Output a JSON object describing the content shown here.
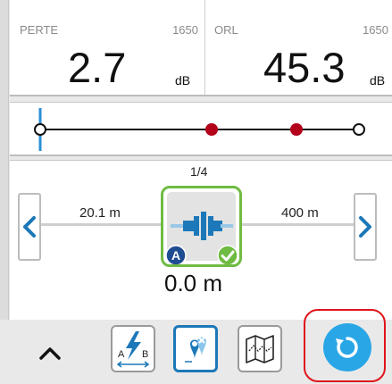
{
  "measurements": {
    "loss": {
      "label": "PERTE",
      "wavelength": "1650",
      "value": "2.7",
      "unit": "dB"
    },
    "orl": {
      "label": "ORL",
      "wavelength": "1650",
      "value": "45.3",
      "unit": "dB"
    }
  },
  "link_map": {
    "events": [
      {
        "icon": "launch-connector-icon",
        "status": "selected",
        "color": "#2a8fd4"
      },
      {
        "icon": "fault-event-icon",
        "status": "fail",
        "color": "#b3001b"
      },
      {
        "icon": "fault-event-icon",
        "status": "fail",
        "color": "#b3001b"
      },
      {
        "icon": "end-event-icon",
        "status": "end",
        "color": "#222222"
      }
    ]
  },
  "event_nav": {
    "counter": "1/4",
    "prev_distance": "20.1 m",
    "next_distance": "400 m",
    "position": "0.0 m",
    "badge": "A",
    "status": "pass",
    "status_color": "#6fbb42"
  },
  "toolbar": {
    "chevron_icon": "chevron-up-icon",
    "tools": [
      {
        "icon": "ab-bidirectional-icon",
        "label_a": "A",
        "label_b": "B",
        "active": false
      },
      {
        "icon": "event-table-icon",
        "active": true
      },
      {
        "icon": "map-icon",
        "active": false
      }
    ],
    "restart_icon": "restart-icon",
    "accent": "#29a6e6",
    "highlight": "#e0141b"
  }
}
